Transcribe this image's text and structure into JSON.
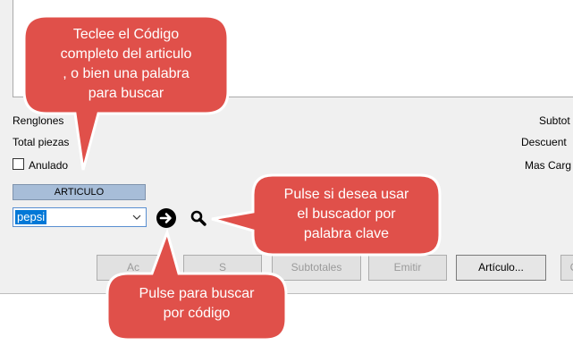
{
  "form": {
    "renglones_label": "Renglones",
    "total_piezas_label": "Total piezas",
    "anulado_label": "Anulado",
    "subtotal_label": "Subtot",
    "descuento_label": "Descuent",
    "mas_cargos_label": "Mas Carg",
    "articulo_label": "ARTICULO",
    "articulo_value": "pepsi"
  },
  "buttons": {
    "b1": "Ac",
    "b2": "S",
    "subtotales": "Subtotales",
    "emitir": "Emitir",
    "articulo": "Artículo...",
    "b6": "C"
  },
  "callouts": {
    "teclee_line1": "Teclee el Código",
    "teclee_line2": "completo del articulo",
    "teclee_line3": ", o bien una palabra",
    "teclee_line4": "para buscar",
    "pulse_buscador_line1": "Pulse si desea usar",
    "pulse_buscador_line2": "el buscador por",
    "pulse_buscador_line3": "palabra clave",
    "pulse_codigo_line1": "Pulse para buscar",
    "pulse_codigo_line2": "por código"
  },
  "colors": {
    "callout_fill": "#e0504a",
    "callout_border": "#c23b36",
    "articulo_header": "#a7bdd8",
    "selection": "#0078d7"
  }
}
